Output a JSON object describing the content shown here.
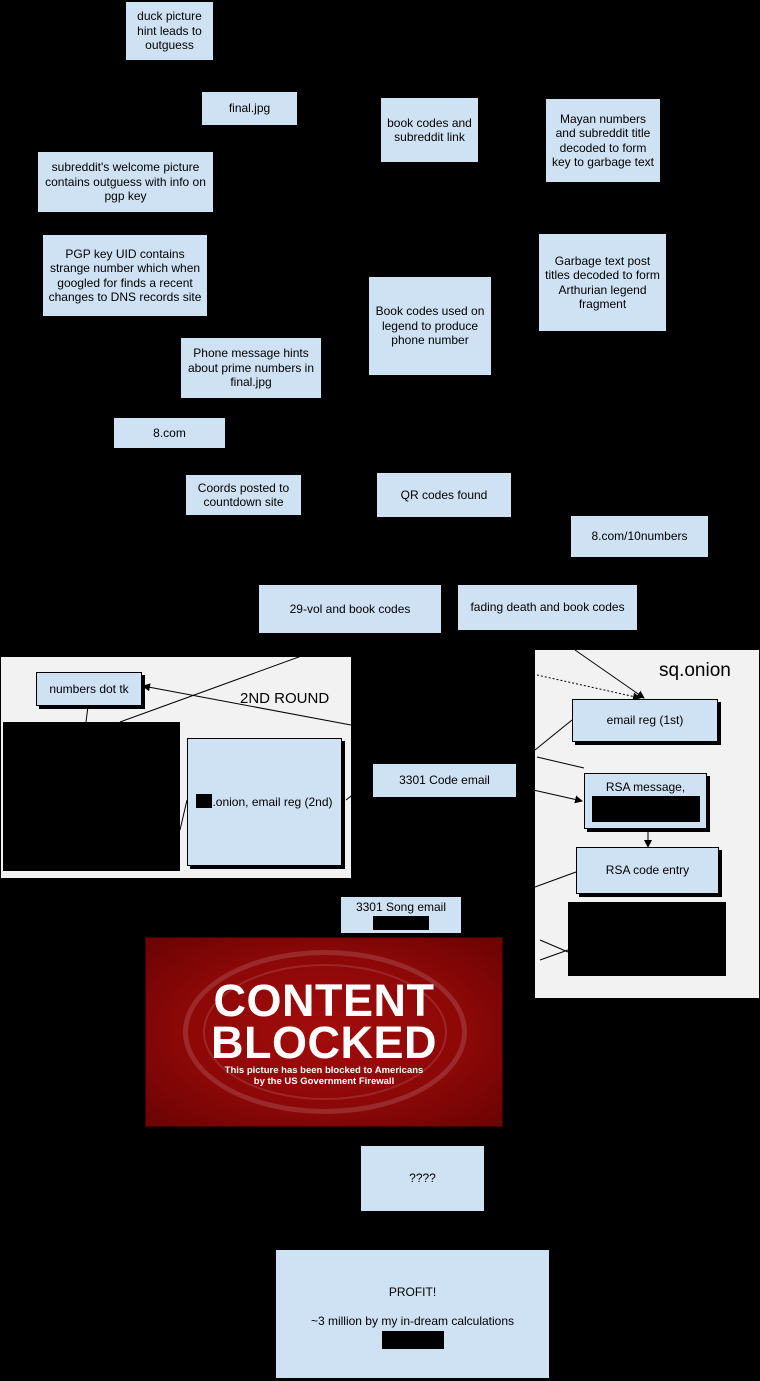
{
  "nodes": {
    "duck": "duck picture hint leads to outguess",
    "final_jpg": "final.jpg",
    "book_codes_subreddit": "book codes and subreddit link",
    "mayan": "Mayan numbers and subreddit title decoded to form key to garbage text",
    "subreddit_welcome": "subreddit's welcome picture contains outguess with info on pgp key",
    "pgp_uid": "PGP key UID contains strange number which when googled for finds a recent changes to DNS records site",
    "garbage_text": "Garbage text post titles decoded to form Arthurian legend fragment",
    "book_codes_legend": "Book codes used on legend to produce phone number",
    "phone_message": "Phone message hints about prime numbers in final.jpg",
    "eight_com": "8.com",
    "coords": "Coords posted to countdown site",
    "qr_codes": "QR codes found",
    "ten_numbers": "8.com/10numbers",
    "vol29": "29-vol and book codes",
    "fading_death": "fading death and book codes",
    "numbers_dot_tk": "numbers dot tk",
    "onion_email_2nd": ".onion, email reg (2nd)",
    "code_email": "3301 Code email",
    "email_reg_1st": "email reg (1st)",
    "rsa_message": "RSA message,",
    "rsa_code_entry": "RSA code entry",
    "song_email": "3301 Song email",
    "unknown": "????",
    "profit_title": "PROFIT!",
    "profit_sub": "~3 million by my in-dream calculations"
  },
  "groups": {
    "second_round": "2ND ROUND",
    "sq_onion": "sq.onion"
  },
  "blocked_image": {
    "title_line1": "CONTENT",
    "title_line2": "BLOCKED",
    "caption_line1": "This picture has been blocked to Americans",
    "caption_line2": "by the US Government Firewall"
  },
  "colors": {
    "background": "#000000",
    "node_fill": "#cfe2f3",
    "group_fill": "#f2f2f2",
    "blocked_red": "#8d0808"
  }
}
